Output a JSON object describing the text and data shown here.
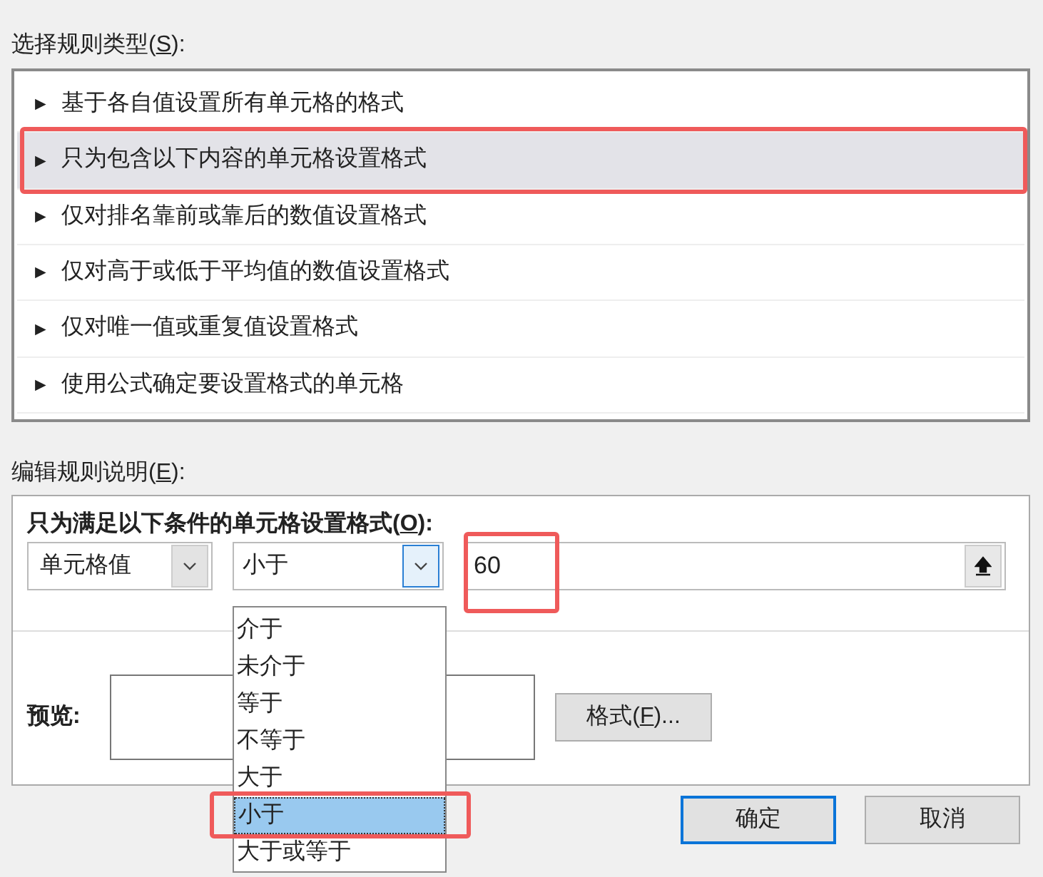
{
  "rule_type": {
    "label": {
      "before": "选择规则类型(",
      "key": "S",
      "after": "):"
    },
    "items": [
      {
        "text": "基于各自值设置所有单元格的格式",
        "selected": false,
        "annotated": false
      },
      {
        "text": "只为包含以下内容的单元格设置格式",
        "selected": true,
        "annotated": true
      },
      {
        "text": "仅对排名靠前或靠后的数值设置格式",
        "selected": false,
        "annotated": false
      },
      {
        "text": "仅对高于或低于平均值的数值设置格式",
        "selected": false,
        "annotated": false
      },
      {
        "text": "仅对唯一值或重复值设置格式",
        "selected": false,
        "annotated": false
      },
      {
        "text": "使用公式确定要设置格式的单元格",
        "selected": false,
        "annotated": false
      }
    ],
    "marker": "►"
  },
  "description": {
    "label": {
      "before": "编辑规则说明(",
      "key": "E",
      "after": "):"
    },
    "title": {
      "before": "只为满足以下条件的单元格设置格式(",
      "key": "O",
      "after": "):"
    },
    "field_type": {
      "value": "单元格值"
    },
    "operator": {
      "value": "小于",
      "expanded": true,
      "options": [
        {
          "text": "介于",
          "selected": false,
          "annotated": false
        },
        {
          "text": "未介于",
          "selected": false,
          "annotated": false
        },
        {
          "text": "等于",
          "selected": false,
          "annotated": false
        },
        {
          "text": "不等于",
          "selected": false,
          "annotated": false
        },
        {
          "text": "大于",
          "selected": false,
          "annotated": false
        },
        {
          "text": "小于",
          "selected": true,
          "annotated": true
        },
        {
          "text": "大于或等于",
          "selected": false,
          "annotated": false
        }
      ]
    },
    "value": {
      "value": "60",
      "annotated": true
    },
    "preview_label": "预览:",
    "format_button": {
      "before": "格式(",
      "key": "F",
      "after": ")..."
    }
  },
  "buttons": [
    {
      "label": "确定",
      "default": true
    },
    {
      "label": "取消",
      "default": false
    }
  ]
}
